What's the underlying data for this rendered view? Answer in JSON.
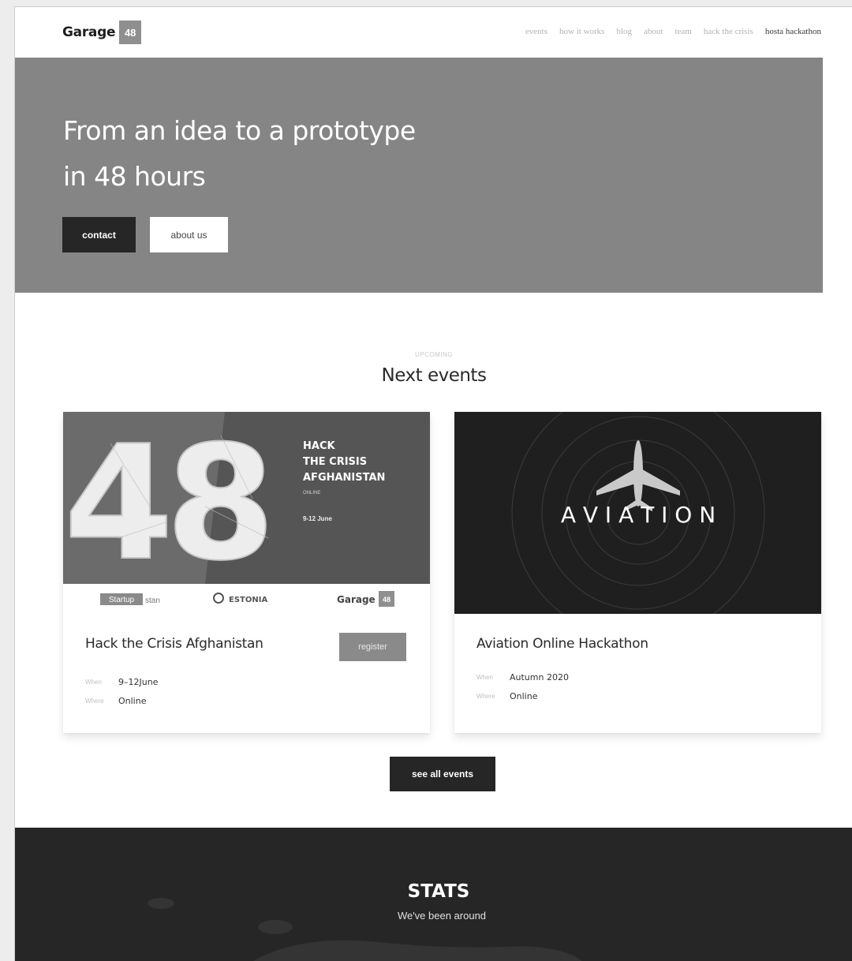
{
  "nav": {
    "logo_text": "Garage",
    "logo_box": "48",
    "items": [
      "events",
      "how it works",
      "blog",
      "about",
      "team",
      "hack the crisis",
      "hosta hackathon"
    ]
  },
  "hero": {
    "title_line1": "From an idea to a prototype",
    "title_line2": "in 48 hours",
    "contact_label": "contact",
    "about_label": "about us"
  },
  "events": {
    "kicker": "UPCOMING",
    "title": "Next events",
    "cards": [
      {
        "image_heading": [
          "HACK",
          "THE CRISIS",
          "AFGHANISTAN"
        ],
        "image_sub": "ONLINE",
        "image_date": "9-12 June",
        "image_number": "48",
        "partner_logos": [
          "Startup",
          "stan",
          "ESTONIA",
          "Garage",
          "48"
        ],
        "title": "Hack the Crisis Afghanistan",
        "register_label": "register",
        "when_label": "When",
        "when_value": "9–12June",
        "where_label": "Where",
        "where_value": "Online"
      },
      {
        "image_word": "A V I A T I O N",
        "title": "Aviation Online Hackathon",
        "when_label": "When",
        "when_value": "Autumn 2020",
        "where_label": "Where",
        "where_value": "Online"
      }
    ],
    "see_all_label": "see all events"
  },
  "stats": {
    "title": "STATS",
    "subtitle": "We've been around"
  }
}
